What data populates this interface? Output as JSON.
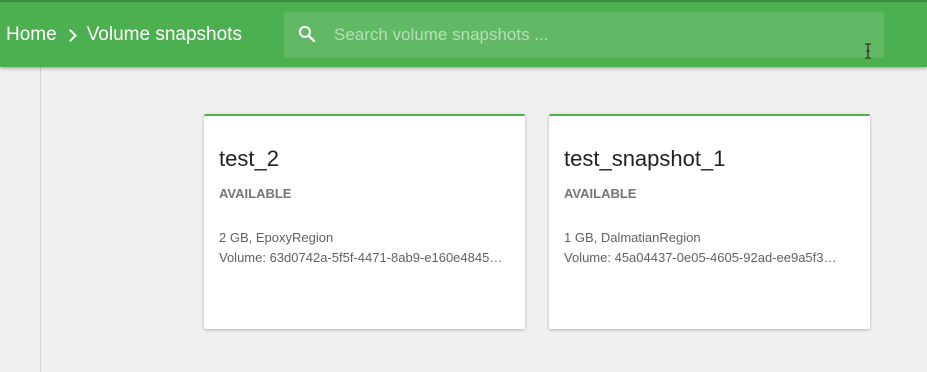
{
  "header": {
    "breadcrumb": {
      "home": "Home",
      "current": "Volume snapshots"
    },
    "search": {
      "placeholder": "Search volume snapshots ...",
      "value": ""
    }
  },
  "snapshots": [
    {
      "name": "test_2",
      "status": "AVAILABLE",
      "summary": "2 GB, EpoxyRegion",
      "volume": "Volume: 63d0742a-5f5f-4471-8ab9-e160e4845…"
    },
    {
      "name": "test_snapshot_1",
      "status": "AVAILABLE",
      "summary": "1 GB, DalmatianRegion",
      "volume": "Volume: 45a04437-0e05-4605-92ad-ee9a5f3…"
    }
  ],
  "colors": {
    "header_bg": "#4caf50",
    "card_accent": "#4caf50",
    "page_bg": "#f0f0f0"
  },
  "icons": {
    "search": "search-icon",
    "separator": "chevron-right-icon",
    "cursor": "text-cursor-icon"
  }
}
